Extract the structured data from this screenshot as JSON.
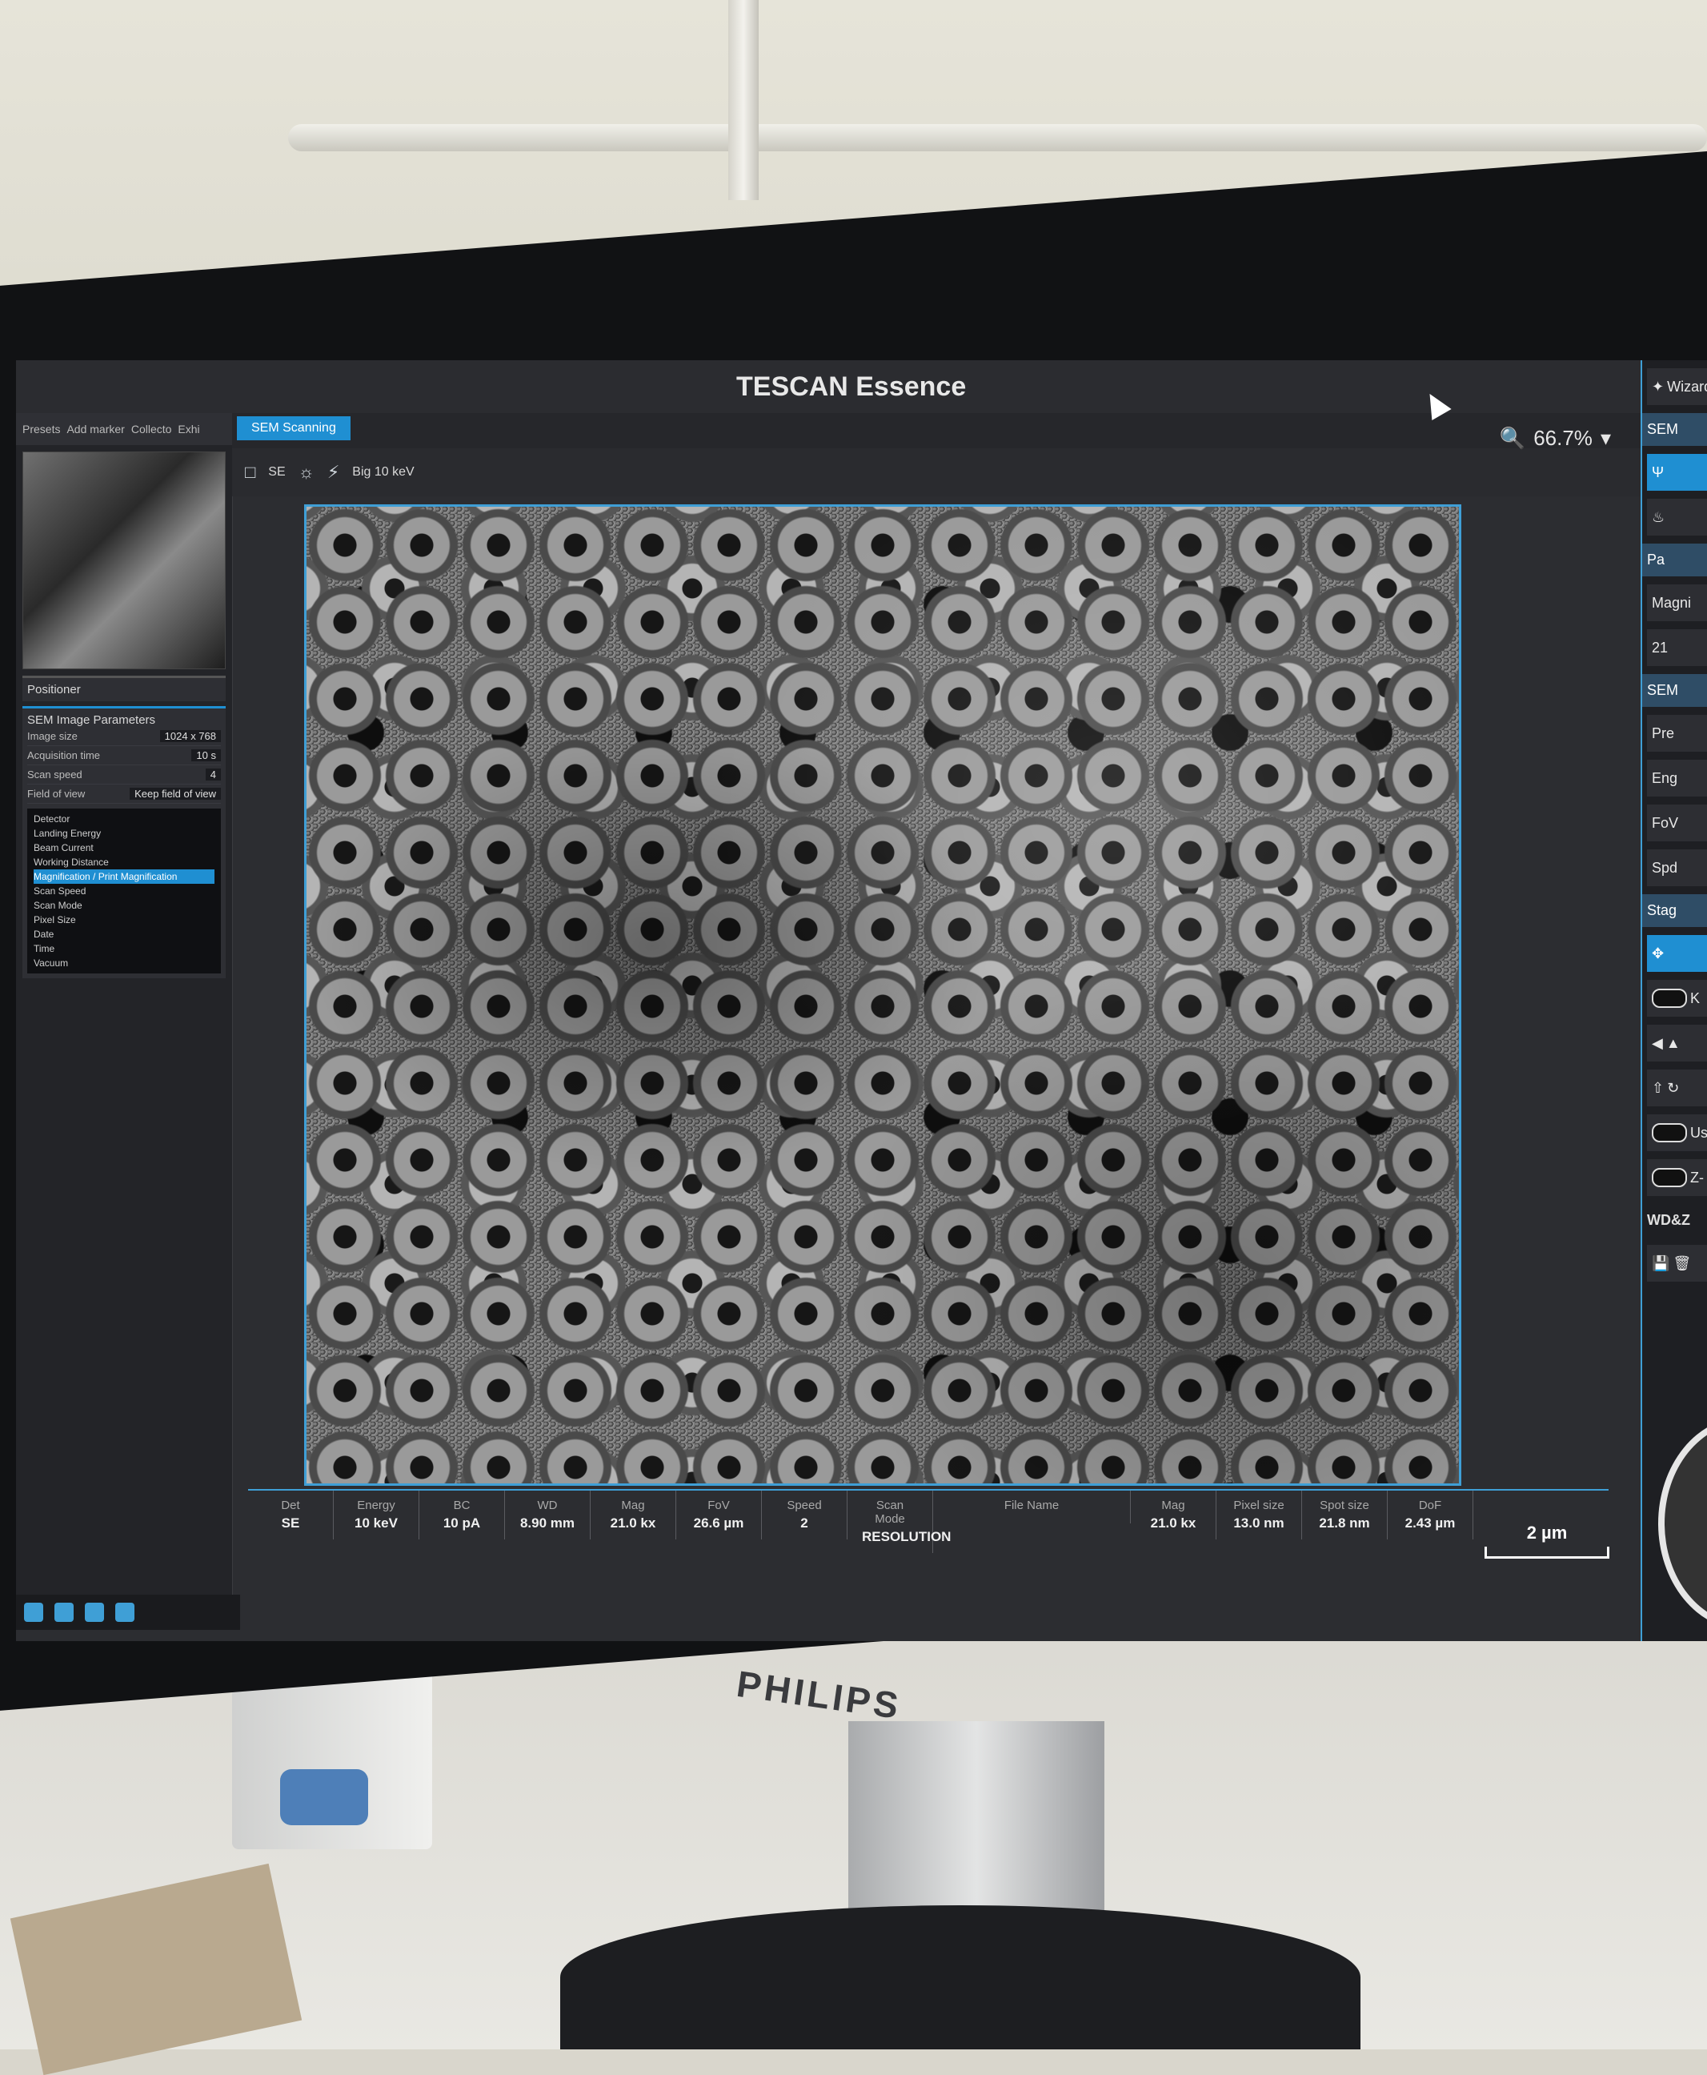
{
  "window": {
    "title": "TESCAN Essence"
  },
  "toolbar": {
    "wizard_label": "Wizard",
    "zoom_level": "66.7%"
  },
  "left_panel": {
    "quick_items": [
      "Presets",
      "Add marker",
      "Collecto",
      "Exhi"
    ],
    "positioner_header": "Positioner",
    "scan_params_header": "SEM Image Parameters",
    "params": [
      {
        "label": "Image size",
        "value": "1024 x 768"
      },
      {
        "label": "Acquisition time",
        "value": "10 s"
      },
      {
        "label": "Scan speed",
        "value": "4"
      },
      {
        "label": "Field of view",
        "value": "Keep field of view"
      }
    ],
    "info_list": [
      "Detector",
      "Landing Energy",
      "Beam Current",
      "Working Distance",
      "Magnification / Print Magnification",
      "Scan Speed",
      "Scan Mode",
      "Pixel Size",
      "Date",
      "Time",
      "Vacuum"
    ]
  },
  "tab": {
    "label": "SEM Scanning"
  },
  "view_tools": {
    "detector": "SE",
    "scan_info": "Big 10 keV"
  },
  "info_bar": [
    {
      "label": "Det",
      "value": "SE"
    },
    {
      "label": "Energy",
      "value": "10 keV"
    },
    {
      "label": "BC",
      "value": "10 pA"
    },
    {
      "label": "WD",
      "value": "8.90 mm"
    },
    {
      "label": "Mag",
      "value": "21.0 kx"
    },
    {
      "label": "FoV",
      "value": "26.6 µm"
    },
    {
      "label": "Speed",
      "value": "2"
    },
    {
      "label": "Scan Mode",
      "value": "RESOLUTION"
    }
  ],
  "file_info": [
    {
      "label": "File Name",
      "value": ""
    },
    {
      "label": "Mag",
      "value": "21.0 kx"
    },
    {
      "label": "Pixel size",
      "value": "13.0 nm"
    },
    {
      "label": "Spot size",
      "value": "21.8 nm"
    },
    {
      "label": "DoF",
      "value": "2.43 µm"
    }
  ],
  "scale_bar": {
    "value": "2 µm",
    "fraction_of_image_width": 0.11
  },
  "right_panel": {
    "items": [
      "SEM",
      "Pa",
      "Magni",
      "21",
      "SEM",
      "Pre",
      "Eng",
      "FoV",
      "Spd",
      "Stag",
      "K",
      "Us",
      "Z-",
      "WD&Z"
    ]
  },
  "monitor": {
    "brand": "PHILIPS"
  },
  "colors": {
    "accent": "#1f8fd2",
    "border": "#3f9fd6",
    "background": "#2c2d31"
  }
}
